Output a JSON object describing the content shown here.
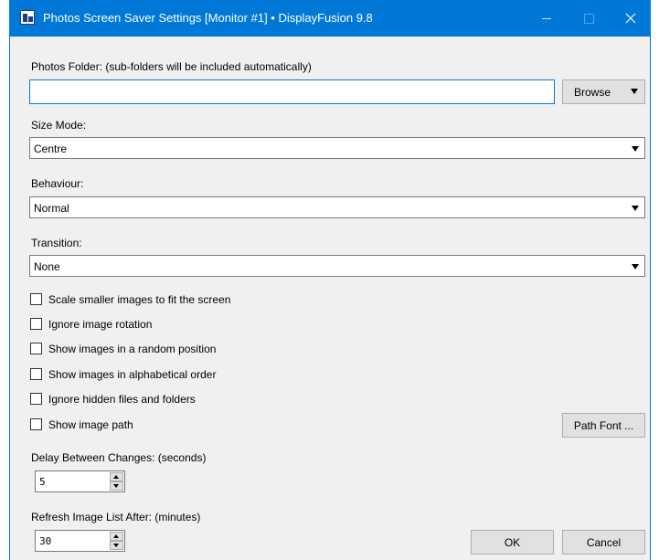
{
  "window": {
    "title": "Photos Screen Saver Settings [Monitor #1] • DisplayFusion 9.8",
    "icon": "displayfusion-icon",
    "accent": "#0078d7"
  },
  "photos_folder": {
    "label": "Photos Folder: (sub-folders will be included automatically)",
    "value": "",
    "browse_label": "Browse"
  },
  "size_mode": {
    "label": "Size Mode:",
    "value": "Centre"
  },
  "behaviour": {
    "label": "Behaviour:",
    "value": "Normal"
  },
  "transition": {
    "label": "Transition:",
    "value": "None"
  },
  "options": [
    {
      "label": "Scale smaller images to fit the screen",
      "checked": false
    },
    {
      "label": "Ignore image rotation",
      "checked": false
    },
    {
      "label": "Show images in a random position",
      "checked": false
    },
    {
      "label": "Show images in alphabetical order",
      "checked": false
    },
    {
      "label": "Ignore hidden files and folders",
      "checked": false
    },
    {
      "label": "Show image path",
      "checked": false
    }
  ],
  "path_font_label": "Path Font ...",
  "delay": {
    "label": "Delay Between Changes: (seconds)",
    "value": "5"
  },
  "refresh": {
    "label": "Refresh Image List After: (minutes)",
    "value": "30"
  },
  "buttons": {
    "ok": "OK",
    "cancel": "Cancel"
  }
}
